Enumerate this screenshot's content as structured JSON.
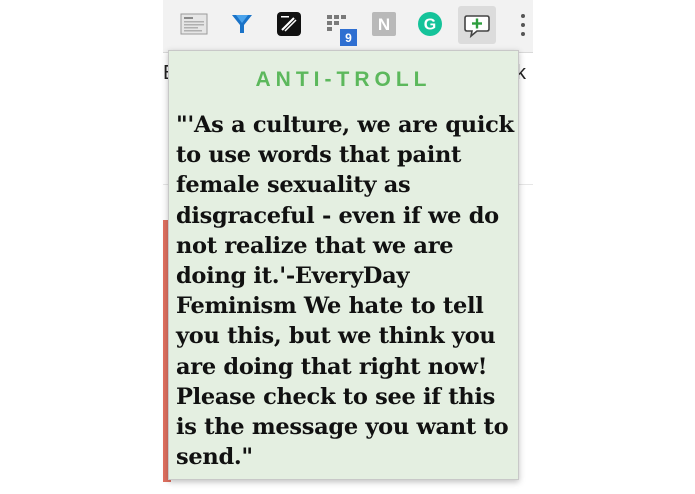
{
  "browser": {
    "underlying_page_text_left": "E",
    "underlying_page_text_right": "k",
    "extension_icons": [
      {
        "name": "screenshot-icon"
      },
      {
        "name": "funnel-icon"
      },
      {
        "name": "editor-icon"
      },
      {
        "name": "grid-icon",
        "badge": "9"
      },
      {
        "name": "notion-icon",
        "letter": "N"
      },
      {
        "name": "grammarly-icon",
        "letter": "G"
      },
      {
        "name": "anti-troll-icon"
      }
    ],
    "menu_icon": "more-vertical-icon"
  },
  "popup": {
    "title": "ANTI-TROLL",
    "message": "\"'As a culture, we are quick to use words that paint female sexuality as disgraceful - even if we do not realize that we are doing it.'-EveryDay Feminism We hate to tell you this, but we think you are doing that right now! Please check to see if this is the message you want to send.\""
  },
  "colors": {
    "title_green": "#5cb85c",
    "popup_background": "#e4efe1",
    "message_text": "#111111",
    "grammarly_green": "#15c39a",
    "badge_blue": "#2f6fd1"
  }
}
